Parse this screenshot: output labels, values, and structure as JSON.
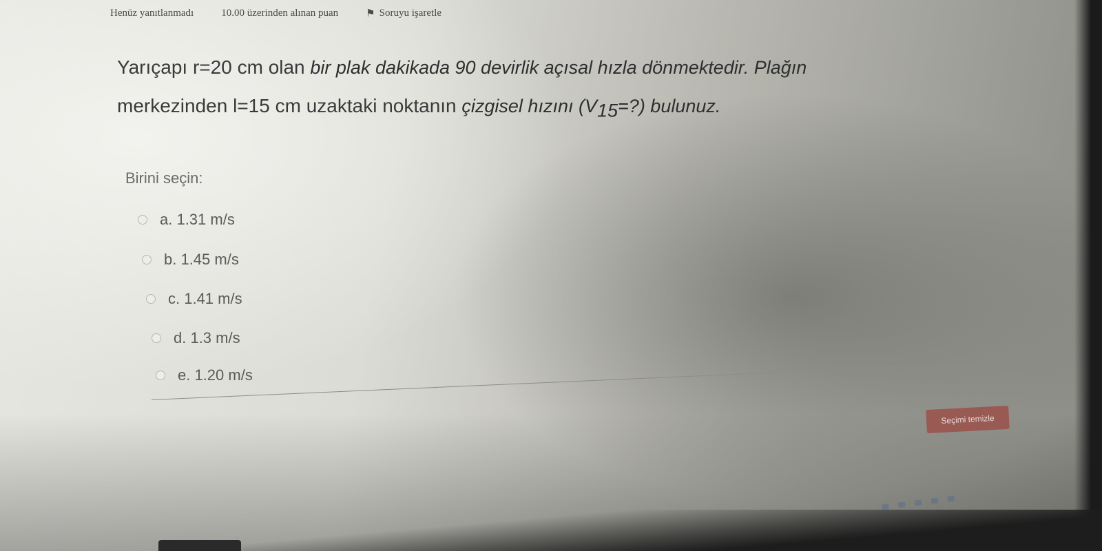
{
  "info": {
    "status": "Henüz yanıtlanmadı",
    "score": "10.00 üzerinden alınan puan",
    "flag_icon": "flag-icon",
    "flag_label": "Soruyu işaretle"
  },
  "question": {
    "p1": "Yarıçapı",
    "p2": "r=20 cm olan ",
    "p3": "bir plak dakikada 90 devirlik açısal hızla dönmektedir. Plağın",
    "p4": "merkezinden ",
    "p5": "l=15 cm",
    "p6": "  uzaktaki noktanın ",
    "p7": "çizgisel hızını (V",
    "p8": "15",
    "p9": "=?) bulunuz."
  },
  "prompt": "Birini seçin:",
  "options": [
    {
      "label": "a. 1.31 m/s"
    },
    {
      "label": "b. 1.45 m/s"
    },
    {
      "label": "c. 1.41 m/s"
    },
    {
      "label": "d. 1.3 m/s"
    },
    {
      "label": "e. 1.20 m/s"
    }
  ],
  "clear_button": "Seçimi temizle",
  "colors": {
    "clear_button_bg": "#9a5a54",
    "text": "#3a3a3a"
  }
}
